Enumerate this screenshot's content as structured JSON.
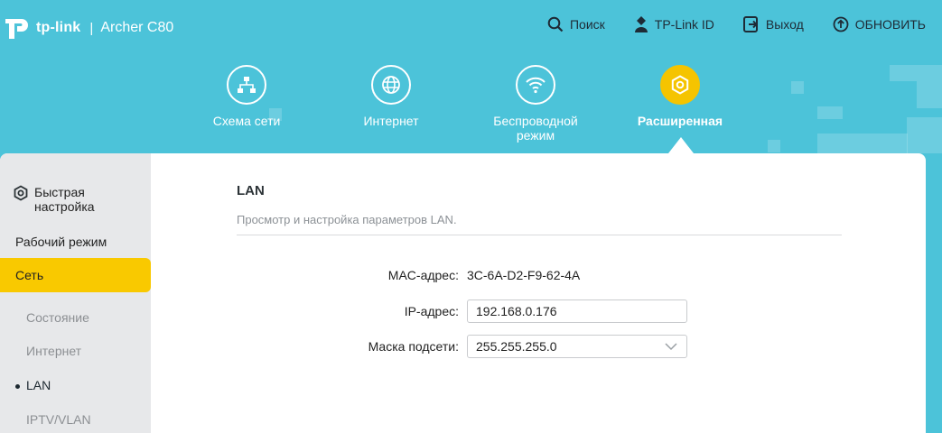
{
  "header": {
    "brand": "tp-link",
    "separator": "|",
    "model": "Archer C80",
    "actions": [
      {
        "label": "Поиск",
        "icon": "search-icon"
      },
      {
        "label": "TP-Link ID",
        "icon": "user-id-icon"
      },
      {
        "label": "Выход",
        "icon": "logout-icon"
      },
      {
        "label": "ОБНОВИТЬ",
        "icon": "refresh-icon"
      }
    ]
  },
  "nav": {
    "items": [
      {
        "label": "Схема сети",
        "icon": "network-map-icon"
      },
      {
        "label": "Интернет",
        "icon": "globe-icon"
      },
      {
        "label": "Беспроводной режим",
        "icon": "wifi-icon"
      },
      {
        "label": "Расширенная",
        "icon": "gear-icon",
        "active": true
      }
    ]
  },
  "sidebar": {
    "quick_setup": "Быстрая настройка",
    "mode": "Рабочий режим",
    "network": "Сеть",
    "subitems": [
      "Состояние",
      "Интернет",
      "LAN",
      "IPTV/VLAN"
    ]
  },
  "lan": {
    "title": "LAN",
    "description": "Просмотр и настройка параметров LAN.",
    "mac_label": "MAC-адрес:",
    "mac_value": "3C-6A-D2-F9-62-4A",
    "ip_label": "IP-адрес:",
    "ip_value": "192.168.0.176",
    "mask_label": "Маска подсети:",
    "mask_value": "255.255.255.0"
  },
  "colors": {
    "header_bg": "#4cc3d9",
    "active_accent": "#f9c900"
  }
}
